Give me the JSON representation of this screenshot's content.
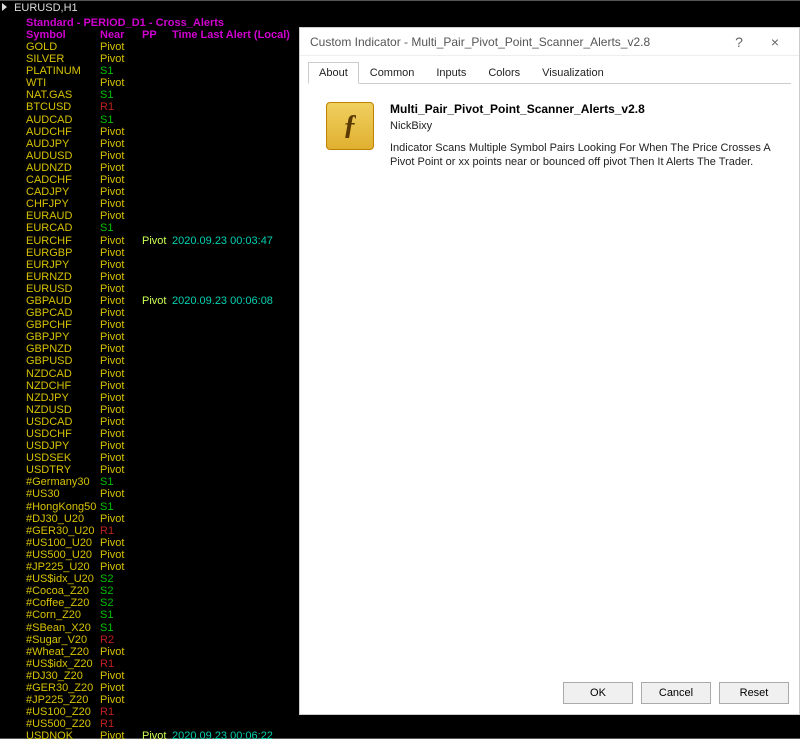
{
  "chart": {
    "title": "EURUSD,H1",
    "header_line": "Standard - PERIOD_D1 - Cross_Alerts",
    "cols": {
      "symbol": "Symbol",
      "near": "Near",
      "pp": "PP",
      "time": "Time Last Alert (Local)"
    }
  },
  "rows": [
    {
      "symbol": "GOLD",
      "near": "Pivot",
      "near_cls": "pivot"
    },
    {
      "symbol": "SILVER",
      "near": "Pivot",
      "near_cls": "pivot"
    },
    {
      "symbol": "PLATINUM",
      "near": "S1",
      "near_cls": "s1"
    },
    {
      "symbol": "WTI",
      "near": "Pivot",
      "near_cls": "pivot"
    },
    {
      "symbol": "NAT.GAS",
      "near": "S1",
      "near_cls": "s1"
    },
    {
      "symbol": "BTCUSD",
      "near": "R1",
      "near_cls": "r1"
    },
    {
      "symbol": "AUDCAD",
      "near": "S1",
      "near_cls": "s1"
    },
    {
      "symbol": "AUDCHF",
      "near": "Pivot",
      "near_cls": "pivot"
    },
    {
      "symbol": "AUDJPY",
      "near": "Pivot",
      "near_cls": "pivot"
    },
    {
      "symbol": "AUDUSD",
      "near": "Pivot",
      "near_cls": "pivot"
    },
    {
      "symbol": "AUDNZD",
      "near": "Pivot",
      "near_cls": "pivot"
    },
    {
      "symbol": "CADCHF",
      "near": "Pivot",
      "near_cls": "pivot"
    },
    {
      "symbol": "CADJPY",
      "near": "Pivot",
      "near_cls": "pivot"
    },
    {
      "symbol": "CHFJPY",
      "near": "Pivot",
      "near_cls": "pivot"
    },
    {
      "symbol": "EURAUD",
      "near": "Pivot",
      "near_cls": "pivot"
    },
    {
      "symbol": "EURCAD",
      "near": "S1",
      "near_cls": "s1"
    },
    {
      "symbol": "EURCHF",
      "near": "Pivot",
      "near_cls": "pivot",
      "pp": "Pivot",
      "time": "2020.09.23 00:03:47"
    },
    {
      "symbol": "EURGBP",
      "near": "Pivot",
      "near_cls": "pivot"
    },
    {
      "symbol": "EURJPY",
      "near": "Pivot",
      "near_cls": "pivot"
    },
    {
      "symbol": "EURNZD",
      "near": "Pivot",
      "near_cls": "pivot"
    },
    {
      "symbol": "EURUSD",
      "near": "Pivot",
      "near_cls": "pivot"
    },
    {
      "symbol": "GBPAUD",
      "near": "Pivot",
      "near_cls": "pivot",
      "pp": "Pivot",
      "time": "2020.09.23 00:06:08"
    },
    {
      "symbol": "GBPCAD",
      "near": "Pivot",
      "near_cls": "pivot"
    },
    {
      "symbol": "GBPCHF",
      "near": "Pivot",
      "near_cls": "pivot"
    },
    {
      "symbol": "GBPJPY",
      "near": "Pivot",
      "near_cls": "pivot"
    },
    {
      "symbol": "GBPNZD",
      "near": "Pivot",
      "near_cls": "pivot"
    },
    {
      "symbol": "GBPUSD",
      "near": "Pivot",
      "near_cls": "pivot"
    },
    {
      "symbol": "NZDCAD",
      "near": "Pivot",
      "near_cls": "pivot"
    },
    {
      "symbol": "NZDCHF",
      "near": "Pivot",
      "near_cls": "pivot"
    },
    {
      "symbol": "NZDJPY",
      "near": "Pivot",
      "near_cls": "pivot"
    },
    {
      "symbol": "NZDUSD",
      "near": "Pivot",
      "near_cls": "pivot"
    },
    {
      "symbol": "USDCAD",
      "near": "Pivot",
      "near_cls": "pivot"
    },
    {
      "symbol": "USDCHF",
      "near": "Pivot",
      "near_cls": "pivot"
    },
    {
      "symbol": "USDJPY",
      "near": "Pivot",
      "near_cls": "pivot"
    },
    {
      "symbol": "USDSEK",
      "near": "Pivot",
      "near_cls": "pivot"
    },
    {
      "symbol": "USDTRY",
      "near": "Pivot",
      "near_cls": "pivot"
    },
    {
      "symbol": "#Germany30",
      "near": "S1",
      "near_cls": "s1"
    },
    {
      "symbol": "#US30",
      "near": "Pivot",
      "near_cls": "pivot"
    },
    {
      "symbol": "#HongKong50",
      "near": "S1",
      "near_cls": "s1"
    },
    {
      "symbol": "#DJ30_U20",
      "near": "Pivot",
      "near_cls": "pivot"
    },
    {
      "symbol": "#GER30_U20",
      "near": "R1",
      "near_cls": "r1"
    },
    {
      "symbol": "#US100_U20",
      "near": "Pivot",
      "near_cls": "pivot"
    },
    {
      "symbol": "#US500_U20",
      "near": "Pivot",
      "near_cls": "pivot"
    },
    {
      "symbol": "#JP225_U20",
      "near": "Pivot",
      "near_cls": "pivot"
    },
    {
      "symbol": "#US$idx_U20",
      "near": "S2",
      "near_cls": "s2"
    },
    {
      "symbol": "#Cocoa_Z20",
      "near": "S2",
      "near_cls": "s2"
    },
    {
      "symbol": "#Coffee_Z20",
      "near": "S2",
      "near_cls": "s2"
    },
    {
      "symbol": "#Corn_Z20",
      "near": "S1",
      "near_cls": "s1"
    },
    {
      "symbol": "#SBean_X20",
      "near": "S1",
      "near_cls": "s1"
    },
    {
      "symbol": "#Sugar_V20",
      "near": "R2",
      "near_cls": "r2"
    },
    {
      "symbol": "#Wheat_Z20",
      "near": "Pivot",
      "near_cls": "pivot"
    },
    {
      "symbol": "#US$idx_Z20",
      "near": "R1",
      "near_cls": "r1"
    },
    {
      "symbol": "#DJ30_Z20",
      "near": "Pivot",
      "near_cls": "pivot"
    },
    {
      "symbol": "#GER30_Z20",
      "near": "Pivot",
      "near_cls": "pivot"
    },
    {
      "symbol": "#JP225_Z20",
      "near": "Pivot",
      "near_cls": "pivot"
    },
    {
      "symbol": "#US100_Z20",
      "near": "R1",
      "near_cls": "r1"
    },
    {
      "symbol": "#US500_Z20",
      "near": "R1",
      "near_cls": "r1"
    },
    {
      "symbol": "USDNOK",
      "near": "Pivot",
      "near_cls": "pivot",
      "pp": "Pivot",
      "time": "2020.09.23 00:06:22"
    }
  ],
  "dialog": {
    "window_title": "Custom Indicator - Multi_Pair_Pivot_Point_Scanner_Alerts_v2.8",
    "tabs": {
      "about": "About",
      "common": "Common",
      "inputs": "Inputs",
      "colors": "Colors",
      "visualization": "Visualization"
    },
    "about": {
      "title": "Multi_Pair_Pivot_Point_Scanner_Alerts_v2.8",
      "author": "NickBixy",
      "description": "Indicator Scans Multiple Symbol Pairs Looking For When The Price Crosses A Pivot Point or xx points near or bounced off pivot Then It Alerts The Trader."
    },
    "buttons": {
      "ok": "OK",
      "cancel": "Cancel",
      "reset": "Reset"
    },
    "help": "?",
    "close": "×"
  }
}
